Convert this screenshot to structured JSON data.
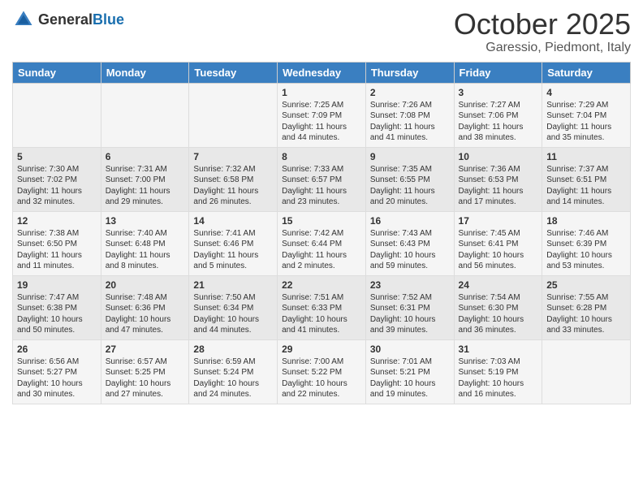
{
  "header": {
    "logo_general": "General",
    "logo_blue": "Blue",
    "month": "October 2025",
    "location": "Garessio, Piedmont, Italy"
  },
  "days_of_week": [
    "Sunday",
    "Monday",
    "Tuesday",
    "Wednesday",
    "Thursday",
    "Friday",
    "Saturday"
  ],
  "weeks": [
    [
      {
        "day": "",
        "text": ""
      },
      {
        "day": "",
        "text": ""
      },
      {
        "day": "",
        "text": ""
      },
      {
        "day": "1",
        "text": "Sunrise: 7:25 AM\nSunset: 7:09 PM\nDaylight: 11 hours and 44 minutes."
      },
      {
        "day": "2",
        "text": "Sunrise: 7:26 AM\nSunset: 7:08 PM\nDaylight: 11 hours and 41 minutes."
      },
      {
        "day": "3",
        "text": "Sunrise: 7:27 AM\nSunset: 7:06 PM\nDaylight: 11 hours and 38 minutes."
      },
      {
        "day": "4",
        "text": "Sunrise: 7:29 AM\nSunset: 7:04 PM\nDaylight: 11 hours and 35 minutes."
      }
    ],
    [
      {
        "day": "5",
        "text": "Sunrise: 7:30 AM\nSunset: 7:02 PM\nDaylight: 11 hours and 32 minutes."
      },
      {
        "day": "6",
        "text": "Sunrise: 7:31 AM\nSunset: 7:00 PM\nDaylight: 11 hours and 29 minutes."
      },
      {
        "day": "7",
        "text": "Sunrise: 7:32 AM\nSunset: 6:58 PM\nDaylight: 11 hours and 26 minutes."
      },
      {
        "day": "8",
        "text": "Sunrise: 7:33 AM\nSunset: 6:57 PM\nDaylight: 11 hours and 23 minutes."
      },
      {
        "day": "9",
        "text": "Sunrise: 7:35 AM\nSunset: 6:55 PM\nDaylight: 11 hours and 20 minutes."
      },
      {
        "day": "10",
        "text": "Sunrise: 7:36 AM\nSunset: 6:53 PM\nDaylight: 11 hours and 17 minutes."
      },
      {
        "day": "11",
        "text": "Sunrise: 7:37 AM\nSunset: 6:51 PM\nDaylight: 11 hours and 14 minutes."
      }
    ],
    [
      {
        "day": "12",
        "text": "Sunrise: 7:38 AM\nSunset: 6:50 PM\nDaylight: 11 hours and 11 minutes."
      },
      {
        "day": "13",
        "text": "Sunrise: 7:40 AM\nSunset: 6:48 PM\nDaylight: 11 hours and 8 minutes."
      },
      {
        "day": "14",
        "text": "Sunrise: 7:41 AM\nSunset: 6:46 PM\nDaylight: 11 hours and 5 minutes."
      },
      {
        "day": "15",
        "text": "Sunrise: 7:42 AM\nSunset: 6:44 PM\nDaylight: 11 hours and 2 minutes."
      },
      {
        "day": "16",
        "text": "Sunrise: 7:43 AM\nSunset: 6:43 PM\nDaylight: 10 hours and 59 minutes."
      },
      {
        "day": "17",
        "text": "Sunrise: 7:45 AM\nSunset: 6:41 PM\nDaylight: 10 hours and 56 minutes."
      },
      {
        "day": "18",
        "text": "Sunrise: 7:46 AM\nSunset: 6:39 PM\nDaylight: 10 hours and 53 minutes."
      }
    ],
    [
      {
        "day": "19",
        "text": "Sunrise: 7:47 AM\nSunset: 6:38 PM\nDaylight: 10 hours and 50 minutes."
      },
      {
        "day": "20",
        "text": "Sunrise: 7:48 AM\nSunset: 6:36 PM\nDaylight: 10 hours and 47 minutes."
      },
      {
        "day": "21",
        "text": "Sunrise: 7:50 AM\nSunset: 6:34 PM\nDaylight: 10 hours and 44 minutes."
      },
      {
        "day": "22",
        "text": "Sunrise: 7:51 AM\nSunset: 6:33 PM\nDaylight: 10 hours and 41 minutes."
      },
      {
        "day": "23",
        "text": "Sunrise: 7:52 AM\nSunset: 6:31 PM\nDaylight: 10 hours and 39 minutes."
      },
      {
        "day": "24",
        "text": "Sunrise: 7:54 AM\nSunset: 6:30 PM\nDaylight: 10 hours and 36 minutes."
      },
      {
        "day": "25",
        "text": "Sunrise: 7:55 AM\nSunset: 6:28 PM\nDaylight: 10 hours and 33 minutes."
      }
    ],
    [
      {
        "day": "26",
        "text": "Sunrise: 6:56 AM\nSunset: 5:27 PM\nDaylight: 10 hours and 30 minutes."
      },
      {
        "day": "27",
        "text": "Sunrise: 6:57 AM\nSunset: 5:25 PM\nDaylight: 10 hours and 27 minutes."
      },
      {
        "day": "28",
        "text": "Sunrise: 6:59 AM\nSunset: 5:24 PM\nDaylight: 10 hours and 24 minutes."
      },
      {
        "day": "29",
        "text": "Sunrise: 7:00 AM\nSunset: 5:22 PM\nDaylight: 10 hours and 22 minutes."
      },
      {
        "day": "30",
        "text": "Sunrise: 7:01 AM\nSunset: 5:21 PM\nDaylight: 10 hours and 19 minutes."
      },
      {
        "day": "31",
        "text": "Sunrise: 7:03 AM\nSunset: 5:19 PM\nDaylight: 10 hours and 16 minutes."
      },
      {
        "day": "",
        "text": ""
      }
    ]
  ]
}
